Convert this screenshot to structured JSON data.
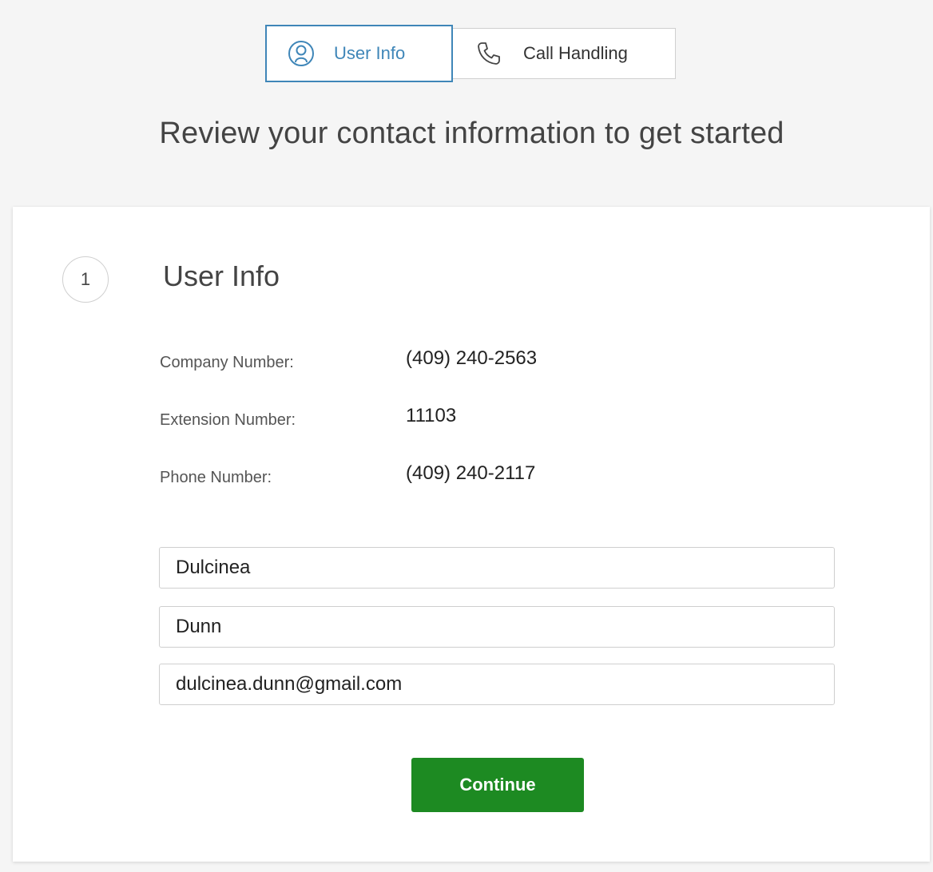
{
  "tabs": [
    {
      "label": "User Info",
      "icon": "user-circle-icon",
      "active": true
    },
    {
      "label": "Call Handling",
      "icon": "phone-icon",
      "active": false
    }
  ],
  "headline": "Review your contact information to get started",
  "section": {
    "step": "1",
    "title": "User Info"
  },
  "info": [
    {
      "label": "Company Number:",
      "value": "(409) 240-2563"
    },
    {
      "label": "Extension Number:",
      "value": "11103"
    },
    {
      "label": "Phone Number:",
      "value": "(409) 240-2117"
    }
  ],
  "form": {
    "first_name": "Dulcinea",
    "last_name": "Dunn",
    "email": "dulcinea.dunn@gmail.com"
  },
  "continue_label": "Continue",
  "colors": {
    "accent": "#3f86b8",
    "primary_button": "#1d8a22",
    "background": "#f5f5f5"
  }
}
